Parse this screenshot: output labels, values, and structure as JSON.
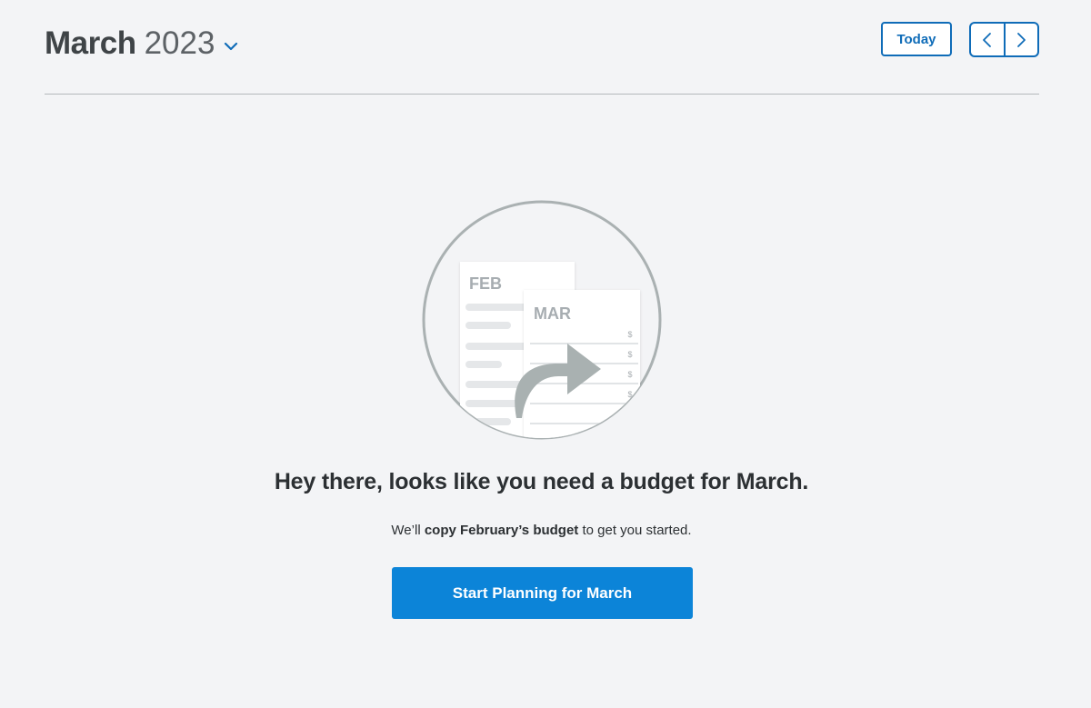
{
  "header": {
    "month": "March",
    "year": "2023",
    "today_label": "Today",
    "chevron_icon": "chevron-down-icon",
    "prev_icon": "chevron-left-icon",
    "next_icon": "chevron-right-icon"
  },
  "illustration": {
    "feb_label": "FEB",
    "mar_label": "MAR",
    "dollar": "$",
    "arrow_icon": "curved-arrow-icon"
  },
  "empty_state": {
    "headline": "Hey there, looks like you need a budget for March.",
    "sub_prefix": "We’ll ",
    "sub_bold": "copy February’s budget",
    "sub_suffix": " to get you started.",
    "cta_label": "Start Planning for March"
  },
  "colors": {
    "accent": "#0f6cb8",
    "cta": "#0c84d8",
    "background": "#f3f4f6"
  }
}
